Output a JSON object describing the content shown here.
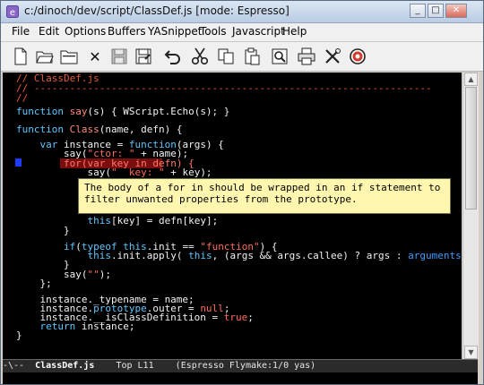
{
  "window": {
    "title": "c:/dinoch/dev/script/ClassDef.js [mode: Espresso]",
    "minimize": "_",
    "maximize": "□",
    "close": "✕"
  },
  "menu": [
    "File",
    "Edit",
    "Options",
    "Buffers",
    "YASnippet",
    "Tools",
    "Javascript",
    "Help"
  ],
  "toolbar": {
    "icons": [
      "new-file-icon",
      "open-folder-icon",
      "open-directory-icon",
      "close-buffer-icon",
      "save-icon",
      "save-as-icon",
      "undo-icon",
      "cut-icon",
      "copy-icon",
      "paste-icon",
      "search-icon",
      "print-icon",
      "customize-icon",
      "help-icon"
    ],
    "close_glyph": "✕"
  },
  "editor": {
    "comment_filename": "// ClassDef.js",
    "comment_rule": "// -------------------------------------------------------------------",
    "comment_blank": "//",
    "lines": {
      "l4a": "function",
      "l4b": " say",
      "l4c": "(s) { WScript.Echo(s); }",
      "l6a": "function",
      "l6b": " Class",
      "l6c": "(name, defn) {",
      "l8a": "    var",
      "l8b": " instance = ",
      "l8c": "function",
      "l8d": "(args) {",
      "l9a": "        say(",
      "l9b": "\"ctor: \"",
      "l9c": " + name);",
      "l10a": "        ",
      "l10b": "for(var key in defn) {",
      "l11a": "            say(",
      "l11b": "\"  key: \"",
      "l11c": " + key);",
      "l14a": "            ",
      "l14b": "this",
      "l14c": "[key] = defn[key];",
      "l15": "        }",
      "l17a": "        ",
      "l17b": "if",
      "l17c": "(",
      "l17d": "typeof",
      "l17e": " ",
      "l17f": "this",
      "l17g": ".init == ",
      "l17h": "\"function\"",
      "l17i": ") {",
      "l18a": "            ",
      "l18b": "this",
      "l18c": ".init.apply( ",
      "l18d": "this",
      "l18e": ", (args && args.callee) ? args : ",
      "l18f": "arguments",
      "l18g": " );",
      "l19": "        }",
      "l20a": "        say(",
      "l20b": "\"\"",
      "l20c": ");",
      "l21": "    };",
      "l23": "    instance._typename = name;",
      "l24a": "    instance.",
      "l24b": "prototype",
      "l24c": ".outer = ",
      "l24d": "null",
      "l24e": ";",
      "l25a": "    instance.__isClassDefinition = ",
      "l25b": "true",
      "l25c": ";",
      "l26a": "    ",
      "l26b": "return",
      "l26c": " instance;",
      "l27": "}"
    },
    "tooltip": "The body of a for in should be wrapped in an if statement to filter unwanted properties from the prototype."
  },
  "modeline": {
    "prefix": "-\\--  ",
    "buffer": "ClassDef.js",
    "position": "    Top L11    ",
    "mode": "(Espresso Flymake:1/0 yas)"
  }
}
